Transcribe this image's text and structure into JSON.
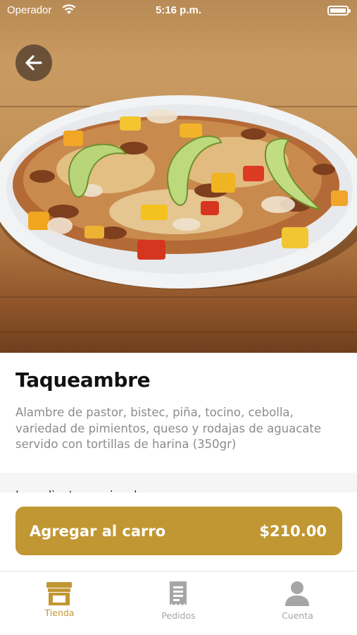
{
  "status_bar": {
    "carrier": "Operador",
    "time": "5:16 p.m."
  },
  "hero": {
    "image": "Taqueambre dish photo on wooden table",
    "back_icon": "arrow-left-icon"
  },
  "product": {
    "name": "Taqueambre",
    "description": "Alambre de pastor, bistec, piña, tocino, cebolla, variedad de pimientos, queso y rodajas de aguacate servido con tortillas de harina (350gr)",
    "options_heading_partial": "Ingredientes opcionales"
  },
  "cart": {
    "label": "Agregar al carro",
    "price": "$210.00"
  },
  "tabs": [
    {
      "label": "Tienda",
      "icon": "store-icon",
      "active": true
    },
    {
      "label": "Pedidos",
      "icon": "receipt-icon",
      "active": false
    },
    {
      "label": "Cuenta",
      "icon": "user-icon",
      "active": false
    }
  ],
  "colors": {
    "accent": "#c19733",
    "inactive": "#a6a6a6",
    "text_primary": "#111111",
    "text_secondary": "#8c8c8c"
  }
}
